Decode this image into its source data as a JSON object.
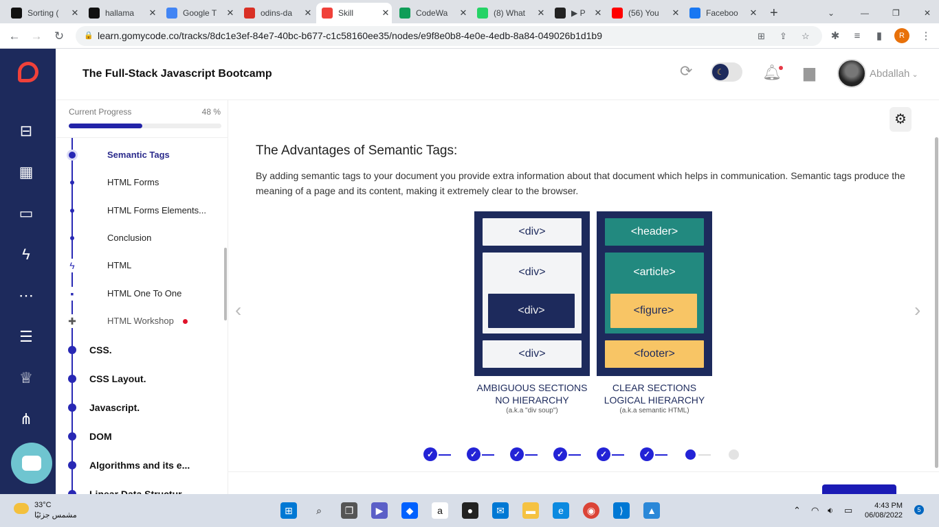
{
  "browser": {
    "tabs": [
      {
        "label": "Sorting (",
        "icon": "va-icon",
        "color": "#111111"
      },
      {
        "label": "hallama",
        "icon": "github-icon",
        "color": "#111111"
      },
      {
        "label": "Google T",
        "icon": "google-translate-icon",
        "color": "#4285f4"
      },
      {
        "label": "odins-da",
        "icon": "odin-icon",
        "color": "#d93025"
      },
      {
        "label": "Skill",
        "icon": "gomycode-icon",
        "color": "#f0413a"
      },
      {
        "label": "CodeWa",
        "icon": "sheets-icon",
        "color": "#0f9d58"
      },
      {
        "label": "(8) What",
        "icon": "whatsapp-icon",
        "color": "#25d366"
      },
      {
        "label": "▶ P",
        "icon": "audio-icon",
        "color": "#222222"
      },
      {
        "label": "(56) You",
        "icon": "youtube-icon",
        "color": "#ff0000"
      },
      {
        "label": "Faceboo",
        "icon": "facebook-icon",
        "color": "#1877f2"
      }
    ],
    "new_tab": "+",
    "url": "learn.gomycode.co/tracks/8dc1e3ef-84e7-40bc-b677-c1c58160ee35/nodes/e9f8e0b8-4e0e-4edb-8a84-049026b1d1b9",
    "profile_initial": "R"
  },
  "header": {
    "course_title": "The Full-Stack Javascript Bootcamp",
    "username": "Abdallah"
  },
  "sidebar": {
    "progress_label": "Current Progress",
    "progress_value": "48 %",
    "progress_fraction": 0.48,
    "lessons": [
      {
        "label": "Semantic Tags",
        "current": true
      },
      {
        "label": "HTML Forms"
      },
      {
        "label": "HTML Forms Elements..."
      },
      {
        "label": "Conclusion"
      },
      {
        "label": "HTML",
        "icon": "bolt-icon"
      },
      {
        "label": "HTML One To One",
        "icon": "chat-icon"
      },
      {
        "label": "HTML Workshop",
        "icon": "puzzle-icon",
        "new": true
      }
    ],
    "sections": [
      "CSS.",
      "CSS Layout.",
      "Javascript.",
      "DOM",
      "Algorithms and its e...",
      "Linear Data Structur..."
    ]
  },
  "content": {
    "title": "The Advantages of Semantic Tags:",
    "paragraph": "By adding semantic tags to your document you provide extra information about that document which helps in communication. Semantic tags produce the meaning of a page and its content, making it extremely clear to the browser.",
    "illustration": {
      "left_blocks": [
        "<div>",
        "<div>",
        "<div>",
        "<div>"
      ],
      "right_blocks": [
        "<header>",
        "<article>",
        "<figure>",
        "<footer>"
      ],
      "left_caption_1": "AMBIGUOUS SECTIONS",
      "left_caption_2": "NO HIERARCHY",
      "left_note": "(a.k.a \"div soup\")",
      "right_caption_1": "CLEAR SECTIONS",
      "right_caption_2": "LOGICAL HIERARCHY",
      "right_note": "(a.k.a semantic HTML)"
    },
    "steps_total": 8,
    "steps_completed": 6,
    "step_current": 7,
    "check_glyph": "✓"
  },
  "taskbar": {
    "temperature": "33°C",
    "weather_text": "مشمس جزئيًا",
    "time": "4:43 PM",
    "date": "06/08/2022",
    "notifications": "5"
  }
}
